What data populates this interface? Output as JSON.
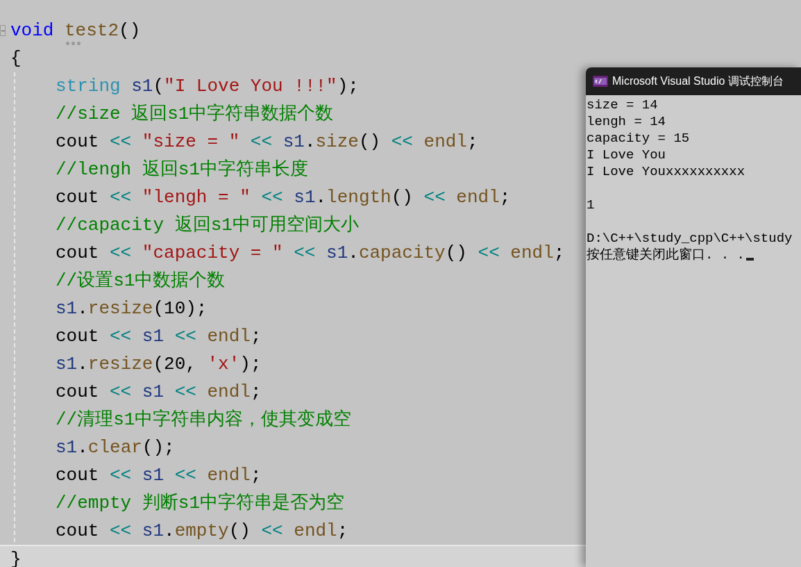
{
  "editor": {
    "functions": [
      {
        "signature": {
          "current": false,
          "tokens": [
            {
              "kind": "keyword",
              "text": "void "
            },
            {
              "kind": "function",
              "text": "test2",
              "hint": true
            },
            {
              "kind": "plain",
              "text": "()"
            }
          ]
        },
        "open": {
          "current": false,
          "tokens": [
            {
              "kind": "plain",
              "text": "{"
            }
          ]
        },
        "body": [
          {
            "current": false,
            "tokens": [
              {
                "kind": "type",
                "text": "string "
              },
              {
                "kind": "variable",
                "text": "s1"
              },
              {
                "kind": "plain",
                "text": "("
              },
              {
                "kind": "string",
                "text": "\"I Love You !!!\""
              },
              {
                "kind": "plain",
                "text": ");"
              }
            ]
          },
          {
            "current": false,
            "tokens": [
              {
                "kind": "comment",
                "text": "//size 返回s1中字符串数据个数"
              }
            ]
          },
          {
            "current": false,
            "tokens": [
              {
                "kind": "plain",
                "text": "cout "
              },
              {
                "kind": "operator",
                "text": "<< "
              },
              {
                "kind": "string",
                "text": "\"size = \" "
              },
              {
                "kind": "operator",
                "text": "<< "
              },
              {
                "kind": "variable",
                "text": "s1"
              },
              {
                "kind": "plain",
                "text": "."
              },
              {
                "kind": "function",
                "text": "size"
              },
              {
                "kind": "plain",
                "text": "() "
              },
              {
                "kind": "operator",
                "text": "<< "
              },
              {
                "kind": "function",
                "text": "endl"
              },
              {
                "kind": "plain",
                "text": ";"
              }
            ]
          },
          {
            "current": false,
            "tokens": [
              {
                "kind": "comment",
                "text": "//lengh 返回s1中字符串长度"
              }
            ]
          },
          {
            "current": false,
            "tokens": [
              {
                "kind": "plain",
                "text": "cout "
              },
              {
                "kind": "operator",
                "text": "<< "
              },
              {
                "kind": "string",
                "text": "\"lengh = \" "
              },
              {
                "kind": "operator",
                "text": "<< "
              },
              {
                "kind": "variable",
                "text": "s1"
              },
              {
                "kind": "plain",
                "text": "."
              },
              {
                "kind": "function",
                "text": "length"
              },
              {
                "kind": "plain",
                "text": "() "
              },
              {
                "kind": "operator",
                "text": "<< "
              },
              {
                "kind": "function",
                "text": "endl"
              },
              {
                "kind": "plain",
                "text": ";"
              }
            ]
          },
          {
            "current": false,
            "tokens": [
              {
                "kind": "comment",
                "text": "//capacity 返回s1中可用空间大小"
              }
            ]
          },
          {
            "current": false,
            "tokens": [
              {
                "kind": "plain",
                "text": "cout "
              },
              {
                "kind": "operator",
                "text": "<< "
              },
              {
                "kind": "string",
                "text": "\"capacity = \" "
              },
              {
                "kind": "operator",
                "text": "<< "
              },
              {
                "kind": "variable",
                "text": "s1"
              },
              {
                "kind": "plain",
                "text": "."
              },
              {
                "kind": "function",
                "text": "capacity"
              },
              {
                "kind": "plain",
                "text": "() "
              },
              {
                "kind": "operator",
                "text": "<< "
              },
              {
                "kind": "function",
                "text": "endl"
              },
              {
                "kind": "plain",
                "text": ";"
              }
            ]
          },
          {
            "current": false,
            "tokens": [
              {
                "kind": "comment",
                "text": "//设置s1中数据个数"
              }
            ]
          },
          {
            "current": false,
            "tokens": [
              {
                "kind": "variable",
                "text": "s1"
              },
              {
                "kind": "plain",
                "text": "."
              },
              {
                "kind": "function",
                "text": "resize"
              },
              {
                "kind": "plain",
                "text": "(10);"
              }
            ]
          },
          {
            "current": false,
            "tokens": [
              {
                "kind": "plain",
                "text": "cout "
              },
              {
                "kind": "operator",
                "text": "<< "
              },
              {
                "kind": "variable",
                "text": "s1 "
              },
              {
                "kind": "operator",
                "text": "<< "
              },
              {
                "kind": "function",
                "text": "endl"
              },
              {
                "kind": "plain",
                "text": ";"
              }
            ]
          },
          {
            "current": false,
            "tokens": [
              {
                "kind": "variable",
                "text": "s1"
              },
              {
                "kind": "plain",
                "text": "."
              },
              {
                "kind": "function",
                "text": "resize"
              },
              {
                "kind": "plain",
                "text": "(20, "
              },
              {
                "kind": "string",
                "text": "'x'"
              },
              {
                "kind": "plain",
                "text": ");"
              }
            ]
          },
          {
            "current": false,
            "tokens": [
              {
                "kind": "plain",
                "text": "cout "
              },
              {
                "kind": "operator",
                "text": "<< "
              },
              {
                "kind": "variable",
                "text": "s1 "
              },
              {
                "kind": "operator",
                "text": "<< "
              },
              {
                "kind": "function",
                "text": "endl"
              },
              {
                "kind": "plain",
                "text": ";"
              }
            ]
          },
          {
            "current": false,
            "tokens": [
              {
                "kind": "comment",
                "text": "//清理s1中字符串内容，使其变成空"
              }
            ]
          },
          {
            "current": false,
            "tokens": [
              {
                "kind": "variable",
                "text": "s1"
              },
              {
                "kind": "plain",
                "text": "."
              },
              {
                "kind": "function",
                "text": "clear"
              },
              {
                "kind": "plain",
                "text": "();"
              }
            ]
          },
          {
            "current": false,
            "tokens": [
              {
                "kind": "plain",
                "text": "cout "
              },
              {
                "kind": "operator",
                "text": "<< "
              },
              {
                "kind": "variable",
                "text": "s1 "
              },
              {
                "kind": "operator",
                "text": "<< "
              },
              {
                "kind": "function",
                "text": "endl"
              },
              {
                "kind": "plain",
                "text": ";"
              }
            ]
          },
          {
            "current": false,
            "tokens": [
              {
                "kind": "comment",
                "text": "//empty 判断s1中字符串是否为空"
              }
            ]
          },
          {
            "current": false,
            "tokens": [
              {
                "kind": "plain",
                "text": "cout "
              },
              {
                "kind": "operator",
                "text": "<< "
              },
              {
                "kind": "variable",
                "text": "s1"
              },
              {
                "kind": "plain",
                "text": "."
              },
              {
                "kind": "function",
                "text": "empty"
              },
              {
                "kind": "plain",
                "text": "() "
              },
              {
                "kind": "operator",
                "text": "<< "
              },
              {
                "kind": "function",
                "text": "endl"
              },
              {
                "kind": "plain",
                "text": ";"
              }
            ]
          }
        ],
        "close": {
          "current": true,
          "tokens": [
            {
              "kind": "plain",
              "text": "}"
            }
          ]
        }
      }
    ]
  },
  "console": {
    "title": "Microsoft Visual Studio 调试控制台",
    "blocks": [
      [
        "size = 14",
        "lengh = 14",
        "capacity = 15",
        "I Love You",
        "I Love Youxxxxxxxxxx"
      ],
      [
        "1"
      ],
      [
        "D:\\C++\\study_cpp\\C++\\study",
        "按任意键关闭此窗口. . ."
      ]
    ]
  }
}
